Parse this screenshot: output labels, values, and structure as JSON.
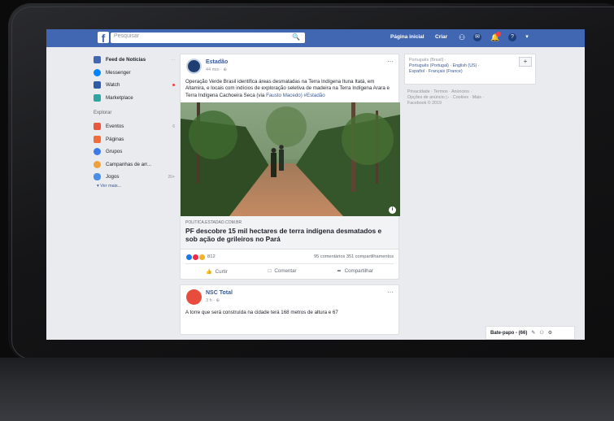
{
  "topbar": {
    "logo": "f",
    "search_placeholder": "Pesquisar",
    "home_label": "Página inicial",
    "create_label": "Criar",
    "colors": {
      "bar": "#4267b2"
    }
  },
  "left_nav": {
    "items": [
      {
        "label": "Feed de Notícias",
        "right": "···",
        "icon": "news-feed-icon",
        "color": "#4267b2"
      },
      {
        "label": "Messenger",
        "right": "",
        "icon": "messenger-icon",
        "color": "#0084ff"
      },
      {
        "label": "Watch",
        "right": "",
        "icon": "watch-icon",
        "color": "#2f5aa8"
      },
      {
        "label": "Marketplace",
        "right": "",
        "icon": "marketplace-icon",
        "color": "#2fa5a0"
      }
    ],
    "explore_label": "Explorar",
    "explore_items": [
      {
        "label": "Eventos",
        "right": "6",
        "icon": "events-icon",
        "color": "#e9573f"
      },
      {
        "label": "Páginas",
        "right": "",
        "icon": "pages-icon",
        "color": "#f26b3a"
      },
      {
        "label": "Grupos",
        "right": "",
        "icon": "groups-icon",
        "color": "#3b7be8"
      },
      {
        "label": "Campanhas de arr...",
        "right": "",
        "icon": "fundraisers-icon",
        "color": "#f0a03a"
      },
      {
        "label": "Jogos",
        "right": "20+",
        "icon": "games-icon",
        "color": "#4a8fe7"
      }
    ],
    "more_label": "▾  Ver mais..."
  },
  "posts": [
    {
      "author": "Estadão",
      "time": "44 min · ⊕",
      "text": "Operação Verde Brasil identifica áreas desmatadas na Terra Indígena Ituna Itatá, em Altamira, e locais com indícios de exploração seletiva de madeira na Terra Indígena Arara e Terra Indígena Cachoeira Seca (via",
      "text_link": "Fausto Macedo) #Estadão",
      "link_domain": "POLITICA.ESTADAO.COM.BR",
      "link_title": "PF descobre 15 mil hectares de terra indígena desmatados e sob ação de grileiros no Pará",
      "reaction_count": "812",
      "comments_shares": "95 comentários  351 compartilhamentos",
      "actions": [
        "Curtir",
        "Comentar",
        "Compartilhar"
      ]
    },
    {
      "author": "NSC Total",
      "time": "3 h · ⊕",
      "text": "A torre que será construída na cidade terá 168 metros de altura e 67"
    }
  ],
  "right_col": {
    "lang_current": "Português (Brasil) ·",
    "lang_line2": "Português (Portugal) · English (US) ·",
    "lang_line3": "Español · Français (France)",
    "plus": "+",
    "footer_line1": "Privacidade · Termos · Anúncios ·",
    "footer_line2": "Opções de anúncio ▷ · Cookies · Mais ·",
    "footer_line3": "Facebook © 2019"
  },
  "chat": {
    "label": "Bate-papo - (66)"
  }
}
